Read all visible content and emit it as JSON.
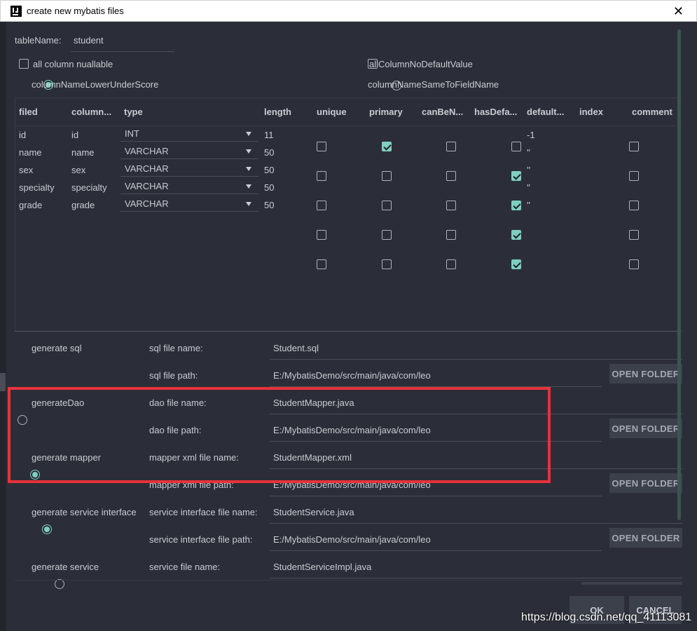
{
  "window": {
    "title": "create new mybatis files"
  },
  "table_name": {
    "label": "tableName:",
    "value": "student"
  },
  "options": {
    "all_column_nullable": {
      "label": "all column nuallable",
      "checked": false
    },
    "all_column_no_default": {
      "label": "allColumnNoDefaultValue",
      "checked": false
    },
    "lower_under_score": {
      "label": "columnNameLowerUnderScore",
      "selected": true
    },
    "same_to_field_name": {
      "label": "columnNameSameToFieldName",
      "selected": false
    }
  },
  "table": {
    "headers": [
      "filed",
      "column...",
      "type",
      "length",
      "unique",
      "primary",
      "canBeN...",
      "hasDefa...",
      "default...",
      "index",
      "comment"
    ],
    "rows": [
      {
        "filed": "id",
        "column": "id",
        "type": "INT",
        "length": "11",
        "unique": false,
        "primary": true,
        "can_be_null": false,
        "has_default": false,
        "default": "-1",
        "index": false
      },
      {
        "filed": "name",
        "column": "name",
        "type": "VARCHAR",
        "length": "50",
        "unique": false,
        "primary": false,
        "can_be_null": false,
        "has_default": true,
        "default": "''",
        "index": false
      },
      {
        "filed": "sex",
        "column": "sex",
        "type": "VARCHAR",
        "length": "50",
        "unique": false,
        "primary": false,
        "can_be_null": false,
        "has_default": true,
        "default": "''",
        "index": false
      },
      {
        "filed": "specialty",
        "column": "specialty",
        "type": "VARCHAR",
        "length": "50",
        "unique": false,
        "primary": false,
        "can_be_null": false,
        "has_default": true,
        "default": "''",
        "index": false
      },
      {
        "filed": "grade",
        "column": "grade",
        "type": "VARCHAR",
        "length": "50",
        "unique": false,
        "primary": false,
        "can_be_null": false,
        "has_default": true,
        "default": "''",
        "index": false
      }
    ]
  },
  "generate": {
    "sql": {
      "label": "generate sql",
      "selected": false
    },
    "dao": {
      "label": "generateDao",
      "selected": true
    },
    "mapper": {
      "label": "generate mapper",
      "selected": true
    },
    "service_interface": {
      "label": "generate service interface",
      "selected": false
    },
    "service": {
      "label": "generate service",
      "selected": false
    }
  },
  "files": [
    {
      "label": "sql file name:",
      "value": "Student.sql"
    },
    {
      "label": "sql file path:",
      "value": "E:/MybatisDemo/src/main/java/com/leo"
    },
    {
      "label": "dao file name:",
      "value": "StudentMapper.java"
    },
    {
      "label": "dao file path:",
      "value": "E:/MybatisDemo/src/main/java/com/leo"
    },
    {
      "label": "mapper xml file name:",
      "value": "StudentMapper.xml"
    },
    {
      "label": "mapper xml file path:",
      "value": "E:/MybatisDemo/src/main/java/com/leo"
    },
    {
      "label": "service interface file name:",
      "value": "StudentService.java"
    },
    {
      "label": "service interface file path:",
      "value": "E:/MybatisDemo/src/main/java/com/leo"
    },
    {
      "label": "service file name:",
      "value": "StudentServiceImpl.java"
    }
  ],
  "buttons": {
    "open_folder": "OPEN FOLDER",
    "ok": "OK",
    "cancel": "CANCEL"
  },
  "watermark": "https://blog.csdn.net/qq_41113081",
  "colors": {
    "accent": "#7fcfbf",
    "highlight": "#e8323a",
    "background": "#2b2e38"
  },
  "icons": {
    "app": "intellij-icon",
    "close": "close-icon"
  }
}
